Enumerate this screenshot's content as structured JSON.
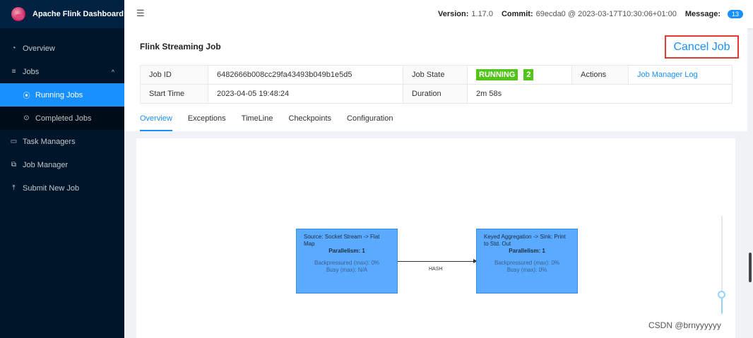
{
  "app": {
    "title": "Apache Flink Dashboard"
  },
  "sidebar": {
    "overview": "Overview",
    "jobs": "Jobs",
    "running_jobs": "Running Jobs",
    "completed_jobs": "Completed Jobs",
    "task_managers": "Task Managers",
    "job_manager": "Job Manager",
    "submit_new_job": "Submit New Job"
  },
  "header": {
    "version_label": "Version:",
    "version_value": "1.17.0",
    "commit_label": "Commit:",
    "commit_value": "69ecda0 @ 2023-03-17T10:30:06+01:00",
    "message_label": "Message:",
    "message_count": "13"
  },
  "job": {
    "title": "Flink Streaming Job",
    "cancel_label": "Cancel Job",
    "job_id_label": "Job ID",
    "job_id_value": "6482666b008cc29fa43493b049b1e5d5",
    "job_state_label": "Job State",
    "job_state_value": "RUNNING",
    "job_state_count": "2",
    "actions_label": "Actions",
    "actions_link": "Job Manager Log",
    "start_time_label": "Start Time",
    "start_time_value": "2023-04-05 19:48:24",
    "duration_label": "Duration",
    "duration_value": "2m 58s"
  },
  "tabs": [
    "Overview",
    "Exceptions",
    "TimeLine",
    "Checkpoints",
    "Configuration"
  ],
  "graph": {
    "nodes": [
      {
        "name": "Source: Socket Stream -> Flat Map",
        "parallelism": "Parallelism: 1",
        "backpressure": "Backpressured (max): 0%",
        "busy": "Busy (max): N/A"
      },
      {
        "name": "Keyed Aggregation -> Sink: Print to Std. Out",
        "parallelism": "Parallelism: 1",
        "backpressure": "Backpressured (max): 0%",
        "busy": "Busy (max): 0%"
      }
    ],
    "edge_label": "HASH"
  },
  "watermark": "CSDN @brnyyyyyy",
  "colors": {
    "primary": "#1890ff",
    "running": "#52c41a",
    "sidebar": "#001529",
    "node": "#5aabff",
    "highlight": "#e53935"
  },
  "icons": [
    "dashboard-icon",
    "menu-icon",
    "play-circle-icon",
    "check-circle-icon",
    "task-icon",
    "cluster-icon",
    "upload-icon",
    "menu-fold-icon"
  ]
}
